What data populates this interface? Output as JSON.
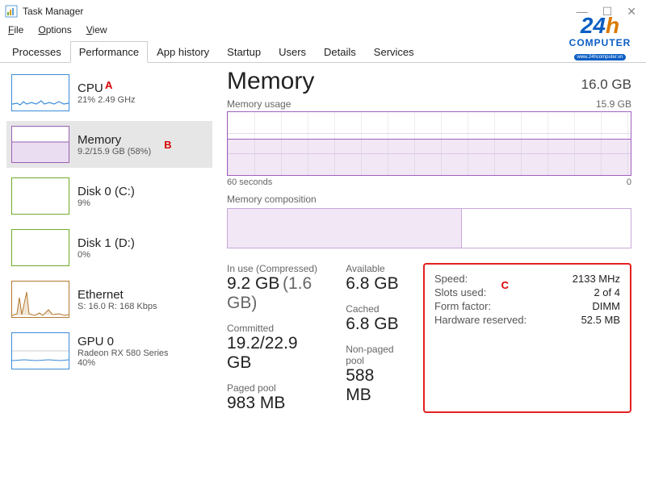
{
  "window": {
    "title": "Task Manager"
  },
  "menu": {
    "file": "File",
    "options": "Options",
    "view": "View"
  },
  "tabs": [
    "Processes",
    "Performance",
    "App history",
    "Startup",
    "Users",
    "Details",
    "Services"
  ],
  "active_tab": 1,
  "annotations": {
    "a": "A",
    "b": "B",
    "c": "C"
  },
  "sidebar": [
    {
      "title": "CPU",
      "sub": "21%  2.49 GHz",
      "color": "#3a8bd8"
    },
    {
      "title": "Memory",
      "sub": "9.2/15.9 GB (58%)",
      "color": "#9a5fb5"
    },
    {
      "title": "Disk 0 (C:)",
      "sub": "9%",
      "color": "#6faa2a"
    },
    {
      "title": "Disk 1 (D:)",
      "sub": "0%",
      "color": "#6faa2a"
    },
    {
      "title": "Ethernet",
      "sub": "S: 16.0  R: 168 Kbps",
      "color": "#b3782c"
    },
    {
      "title": "GPU 0",
      "sub": "Radeon RX 580 Series",
      "sub2": "40%",
      "color": "#3a8bd8"
    }
  ],
  "main": {
    "title": "Memory",
    "total": "16.0 GB",
    "usage_label": "Memory usage",
    "usage_max": "15.9 GB",
    "axis_left": "60 seconds",
    "axis_right": "0",
    "comp_label": "Memory composition",
    "stats": {
      "in_use_lbl": "In use (Compressed)",
      "in_use": "9.2 GB",
      "in_use_comp": "(1.6 GB)",
      "available_lbl": "Available",
      "available": "6.8 GB",
      "committed_lbl": "Committed",
      "committed": "19.2/22.9 GB",
      "cached_lbl": "Cached",
      "cached": "6.8 GB",
      "paged_lbl": "Paged pool",
      "paged": "983 MB",
      "nonpaged_lbl": "Non-paged pool",
      "nonpaged": "588 MB"
    },
    "hw": {
      "speed_k": "Speed:",
      "speed_v": "2133 MHz",
      "slots_k": "Slots used:",
      "slots_v": "2 of 4",
      "form_k": "Form factor:",
      "form_v": "DIMM",
      "hwres_k": "Hardware reserved:",
      "hwres_v": "52.5 MB"
    }
  },
  "logo": {
    "n": "24",
    "h": "h",
    "cp": "COMPUTER",
    "url": "www.24hcomputer.vn"
  }
}
